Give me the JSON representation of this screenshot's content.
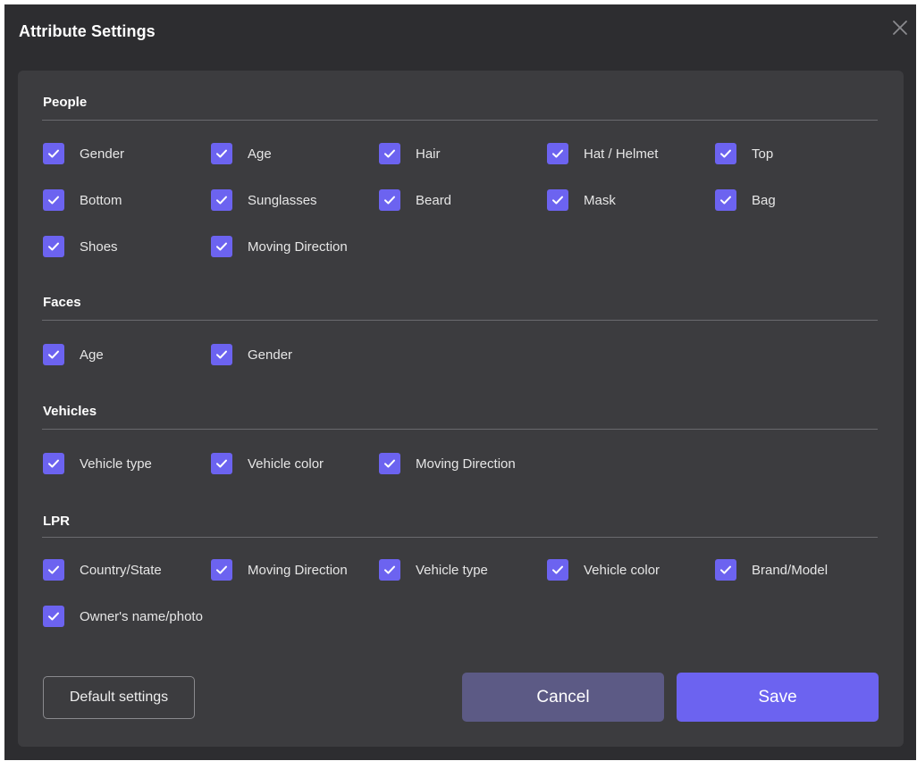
{
  "dialog": {
    "title": "Attribute Settings"
  },
  "sections": [
    {
      "title": "People",
      "items": [
        {
          "label": "Gender",
          "checked": true
        },
        {
          "label": "Age",
          "checked": true
        },
        {
          "label": "Hair",
          "checked": true
        },
        {
          "label": "Hat / Helmet",
          "checked": true
        },
        {
          "label": "Top",
          "checked": true
        },
        {
          "label": "Bottom",
          "checked": true
        },
        {
          "label": "Sunglasses",
          "checked": true
        },
        {
          "label": "Beard",
          "checked": true
        },
        {
          "label": "Mask",
          "checked": true
        },
        {
          "label": "Bag",
          "checked": true
        },
        {
          "label": "Shoes",
          "checked": true
        },
        {
          "label": "Moving Direction",
          "checked": true
        }
      ]
    },
    {
      "title": "Faces",
      "items": [
        {
          "label": "Age",
          "checked": true
        },
        {
          "label": "Gender",
          "checked": true
        }
      ]
    },
    {
      "title": "Vehicles",
      "items": [
        {
          "label": "Vehicle type",
          "checked": true
        },
        {
          "label": "Vehicle color",
          "checked": true
        },
        {
          "label": "Moving Direction",
          "checked": true
        }
      ]
    },
    {
      "title": "LPR",
      "items": [
        {
          "label": "Country/State",
          "checked": true
        },
        {
          "label": "Moving Direction",
          "checked": true
        },
        {
          "label": "Vehicle type",
          "checked": true
        },
        {
          "label": "Vehicle color",
          "checked": true
        },
        {
          "label": "Brand/Model",
          "checked": true
        },
        {
          "label": "Owner's name/photo",
          "checked": true
        }
      ]
    }
  ],
  "buttons": {
    "default_label": "Default settings",
    "cancel_label": "Cancel",
    "save_label": "Save"
  },
  "colors": {
    "accent": "#6c63f0",
    "cancel": "#5c5a85",
    "panel": "#3c3c3f",
    "background": "#2d2d30"
  }
}
